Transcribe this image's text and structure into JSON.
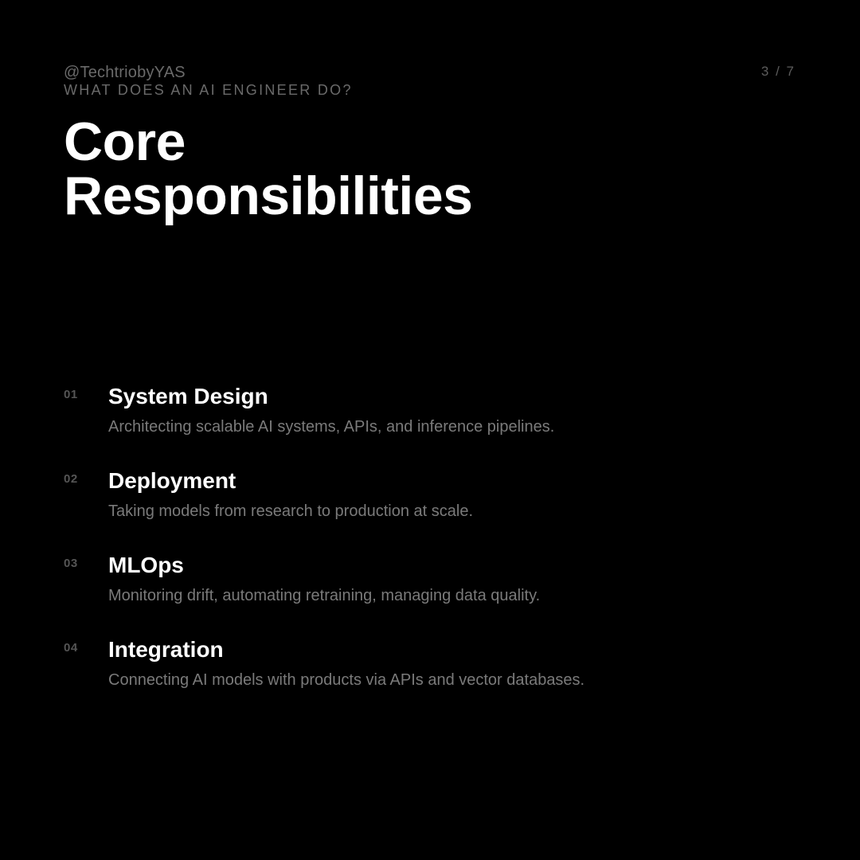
{
  "header": {
    "handle": "@TechtriobyYAS",
    "eyebrow": "WHAT DOES AN AI ENGINEER DO?",
    "page_counter": "3 / 7"
  },
  "title": {
    "line1": "Core",
    "line2": "Responsibilities"
  },
  "items": [
    {
      "number": "01",
      "heading": "System Design",
      "description": "Architecting scalable AI systems, APIs, and inference pipelines."
    },
    {
      "number": "02",
      "heading": "Deployment",
      "description": "Taking models from research to production at scale."
    },
    {
      "number": "03",
      "heading": "MLOps",
      "description": "Monitoring drift, automating retraining, managing data quality."
    },
    {
      "number": "04",
      "heading": "Integration",
      "description": "Connecting AI models with products via APIs and vector databases."
    }
  ],
  "colors": {
    "background": "#000000",
    "title": "#ffffff",
    "muted": "#7a7a7a"
  }
}
